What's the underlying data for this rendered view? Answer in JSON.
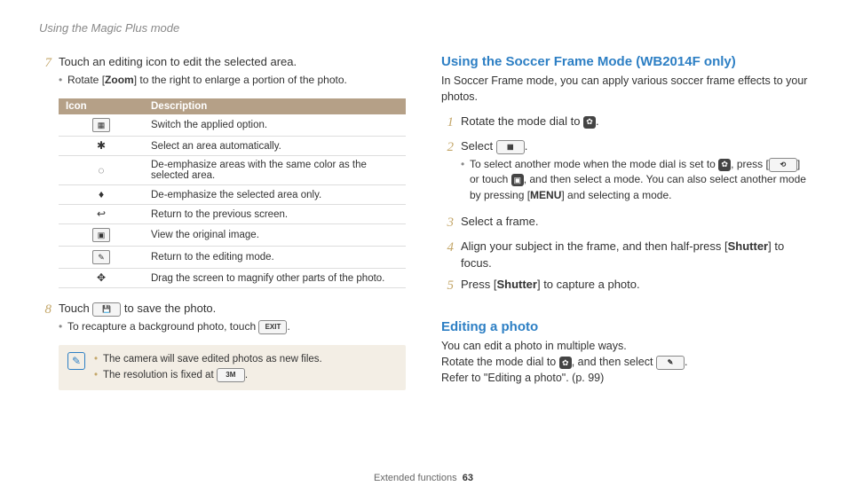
{
  "header": "Using the Magic Plus mode",
  "footer_label": "Extended functions",
  "page_number": "63",
  "left": {
    "step7_num": "7",
    "step7_text": "Touch an editing icon to edit the selected area.",
    "step7_sub_pre": "Rotate [",
    "step7_sub_bold": "Zoom",
    "step7_sub_post": "] to the right to enlarge a portion of the photo.",
    "table": {
      "h_icon": "Icon",
      "h_desc": "Description",
      "rows": [
        {
          "icon": "▦",
          "desc": "Switch the applied option."
        },
        {
          "icon": "✱",
          "desc": "Select an area automatically."
        },
        {
          "icon": "◌",
          "desc": "De-emphasize areas with the same color as the selected area."
        },
        {
          "icon": "♦",
          "desc": "De-emphasize the selected area only."
        },
        {
          "icon": "↩",
          "desc": "Return to the previous screen."
        },
        {
          "icon": "▣",
          "desc": "View the original image."
        },
        {
          "icon": "✎",
          "desc": "Return to the editing mode."
        },
        {
          "icon": "✥",
          "desc": "Drag the screen to magnify other parts of the photo."
        }
      ]
    },
    "step8_num": "8",
    "step8_pre": "Touch ",
    "step8_icon": "💾",
    "step8_post": " to save the photo.",
    "step8_sub_pre": "To recapture a background photo, touch ",
    "step8_sub_badge": "EXIT",
    "step8_sub_post": ".",
    "note1": "The camera will save edited photos as new files.",
    "note2_pre": "The resolution is fixed at ",
    "note2_badge": "3M",
    "note2_post": "."
  },
  "right": {
    "h1": "Using the Soccer Frame Mode (WB2014F only)",
    "intro": "In Soccer Frame mode, you can apply various soccer frame effects to your photos.",
    "s1_num": "1",
    "s1_pre": "Rotate the mode dial to ",
    "s1_icon": "✿",
    "s1_post": ".",
    "s2_num": "2",
    "s2_pre": "Select ",
    "s2_icon": "▦",
    "s2_post": ".",
    "s2_sub_a": "To select another mode when the mode dial is set to ",
    "s2_sub_b": ", press [",
    "s2_sub_c": "] or touch ",
    "s2_sub_d": ", and then select a mode. You can also select another mode by pressing [",
    "s2_sub_e": "] and selecting a mode.",
    "badge_back": "⟲",
    "badge_home": "▣",
    "badge_menu": "MENU",
    "s3_num": "3",
    "s3_text": "Select a frame.",
    "s4_num": "4",
    "s4_pre": "Align your subject in the frame, and then half-press [",
    "s4_bold": "Shutter",
    "s4_post": "] to focus.",
    "s5_num": "5",
    "s5_pre": "Press [",
    "s5_bold": "Shutter",
    "s5_post": "] to capture a photo.",
    "h2": "Editing a photo",
    "e_intro": "You can edit a photo in multiple ways.",
    "e_l2a": "Rotate the mode dial to ",
    "e_l2b": ", and then select ",
    "e_l2c": ".",
    "e_l3": "Refer to \"Editing a photo\". (p. 99)"
  }
}
